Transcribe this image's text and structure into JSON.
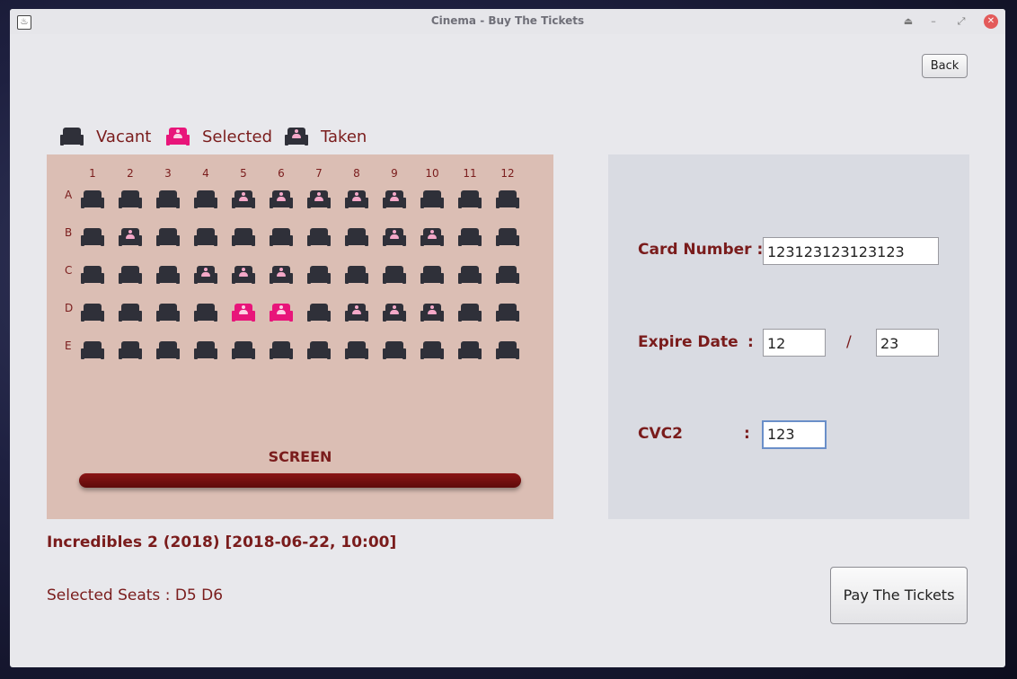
{
  "window": {
    "title": "Cinema - Buy The Tickets",
    "controls": [
      "⏏",
      "–",
      "⤢",
      "✕"
    ]
  },
  "back_label": "Back",
  "legend": [
    {
      "label": "Vacant",
      "state": "vacant"
    },
    {
      "label": "Selected",
      "state": "selected"
    },
    {
      "label": "Taken",
      "state": "taken"
    }
  ],
  "hall": {
    "columns": [
      "1",
      "2",
      "3",
      "4",
      "5",
      "6",
      "7",
      "8",
      "9",
      "10",
      "11",
      "12"
    ],
    "rows": [
      {
        "label": "A",
        "seats": [
          "V",
          "V",
          "V",
          "V",
          "T",
          "T",
          "T",
          "T",
          "T",
          "V",
          "V",
          "V"
        ]
      },
      {
        "label": "B",
        "seats": [
          "V",
          "T",
          "V",
          "V",
          "V",
          "V",
          "V",
          "V",
          "T",
          "T",
          "V",
          "V"
        ]
      },
      {
        "label": "C",
        "seats": [
          "V",
          "V",
          "V",
          "T",
          "T",
          "T",
          "V",
          "V",
          "V",
          "V",
          "V",
          "V"
        ]
      },
      {
        "label": "D",
        "seats": [
          "V",
          "V",
          "V",
          "V",
          "S",
          "S",
          "V",
          "T",
          "T",
          "T",
          "V",
          "V"
        ]
      },
      {
        "label": "E",
        "seats": [
          "V",
          "V",
          "V",
          "V",
          "V",
          "V",
          "V",
          "V",
          "V",
          "V",
          "V",
          "V"
        ]
      }
    ],
    "screen_label": "SCREEN"
  },
  "payment": {
    "card_number_label": "Card Number :",
    "card_number_value": "123123123123123",
    "expire_label": "Expire Date",
    "expire_colon": ":",
    "expire_month": "12",
    "expire_sep": "/",
    "expire_year": "23",
    "cvc_label": "CVC2",
    "cvc_colon": ":",
    "cvc_value": "123"
  },
  "movie_title": "Incredibles 2 (2018) [2018-06-22, 10:00]",
  "selected_seats_text": "Selected Seats :  D5 D6",
  "pay_label": "Pay The Tickets",
  "colors": {
    "accent": "#7a1c1c",
    "selected_seat": "#e8157a",
    "seat_dark": "#2f3039",
    "hall_bg": "#dbbeb4"
  }
}
